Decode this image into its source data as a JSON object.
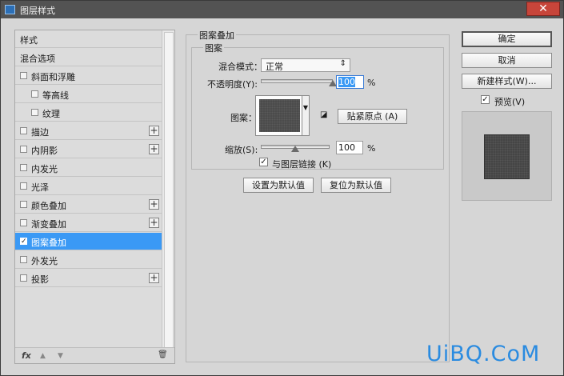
{
  "window": {
    "title": "图层样式",
    "close_symbol": "✕"
  },
  "style_list": {
    "header": "样式",
    "blend_options": "混合选项",
    "items": [
      {
        "label": "斜面和浮雕",
        "checked": false,
        "plus": false
      },
      {
        "label": "等高线",
        "checked": false,
        "plus": false
      },
      {
        "label": "纹理",
        "checked": false,
        "plus": false
      },
      {
        "label": "描边",
        "checked": false,
        "plus": true
      },
      {
        "label": "内阴影",
        "checked": false,
        "plus": true
      },
      {
        "label": "内发光",
        "checked": false,
        "plus": false
      },
      {
        "label": "光泽",
        "checked": false,
        "plus": false
      },
      {
        "label": "颜色叠加",
        "checked": false,
        "plus": true
      },
      {
        "label": "渐变叠加",
        "checked": false,
        "plus": true
      },
      {
        "label": "图案叠加",
        "checked": true,
        "plus": false
      },
      {
        "label": "外发光",
        "checked": false,
        "plus": false
      },
      {
        "label": "投影",
        "checked": false,
        "plus": true
      }
    ],
    "bottom_icons": {
      "fx": "fx",
      "up": "▲",
      "down": "▼",
      "trash": "🗑"
    }
  },
  "pattern_overlay": {
    "group_title": "图案叠加",
    "subgroup_title": "图案",
    "blend_mode_label": "混合模式：",
    "blend_mode_value": "正常",
    "opacity_label": "不透明度(Y):",
    "opacity_value": "100",
    "opacity_unit": "%",
    "pattern_label": "图案：",
    "snap_origin_button": "贴紧原点 (A)",
    "scale_label": "缩放(S):",
    "scale_value": "100",
    "scale_unit": "%",
    "link_layer_label": "与图层链接 (K)",
    "link_layer_checked": true,
    "set_default_button": "设置为默认值",
    "reset_default_button": "复位为默认值"
  },
  "sliders": {
    "opacity_fraction": 1.0,
    "scale_fraction": 0.5
  },
  "actions": {
    "ok": "确定",
    "cancel": "取消",
    "new_style": "新建样式(W)...",
    "preview_label": "预览(V)",
    "preview_checked": true
  },
  "watermark": "UiBQ.CoM",
  "colors": {
    "selection": "#3a99f5",
    "titlebar": "#535353",
    "watermark": "#2a8be0"
  }
}
